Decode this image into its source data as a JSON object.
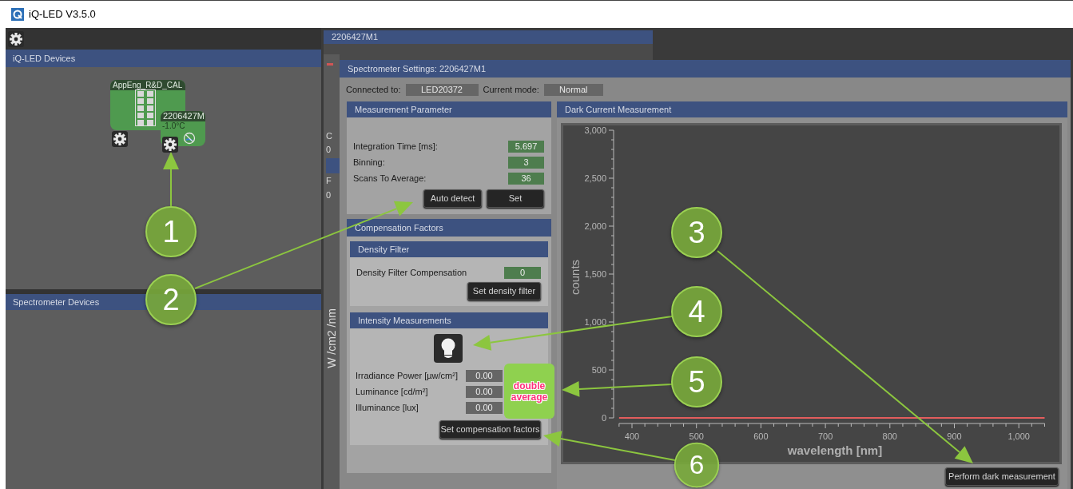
{
  "window": {
    "title": "iQ-LED V3.5.0"
  },
  "left_panel": {
    "sections": [
      {
        "title": "iQ-LED Devices"
      },
      {
        "title": "Spectrometer Devices"
      }
    ],
    "devices": [
      {
        "kind": "led",
        "name": "AppEng_R&D_CAL"
      },
      {
        "kind": "spectrometer",
        "name": "2206427M",
        "temperature": "-1.0°C"
      }
    ]
  },
  "background_window": {
    "tab": "2206427M1",
    "texts": [
      "C",
      "0",
      "F",
      "0"
    ],
    "axis_label": "W /cm2 /nm"
  },
  "dialog": {
    "title": "Spectrometer Settings: 2206427M1",
    "connected_label": "Connected to:",
    "connected_value": "LED20372",
    "mode_label": "Current mode:",
    "mode_value": "Normal",
    "measurement": {
      "title": "Measurement Parameter",
      "fields": [
        {
          "label": "Integration Time [ms]:",
          "value": "5.697"
        },
        {
          "label": "Binning:",
          "value": "3"
        },
        {
          "label": "Scans To Average:",
          "value": "36"
        }
      ],
      "buttons": [
        "Auto detect",
        "Set"
      ]
    },
    "compensation": {
      "title": "Compensation Factors",
      "density": {
        "title": "Density Filter",
        "label": "Density Filter Compensation",
        "value": "0",
        "button": "Set density filter"
      },
      "intensity": {
        "title": "Intensity Measurements",
        "fields": [
          {
            "label": "Irradiance Power [µw/cm²]",
            "value": "0.00"
          },
          {
            "label": "Luminance [cd/m²]",
            "value": "0.00"
          },
          {
            "label": "Illuminance [lux]",
            "value": "0.00"
          }
        ],
        "button": "Set compensation factors"
      }
    },
    "dark_current": {
      "title": "Dark Current Measurement",
      "button": "Perform dark measurement",
      "chart_data": {
        "type": "line",
        "xlabel": "wavelength [nm]",
        "ylabel": "counts",
        "xlim": [
          380,
          1040
        ],
        "ylim": [
          0,
          3000
        ],
        "x": [
          380,
          1040
        ],
        "series": [
          {
            "color": "#e35d5d",
            "values": [
              0,
              0
            ]
          }
        ],
        "xticks": [
          400,
          500,
          600,
          700,
          800,
          900,
          {
            "value": 1000,
            "label": "1,000"
          }
        ],
        "yticks": [
          0,
          500,
          {
            "value": 1000,
            "label": "1,000"
          },
          {
            "value": 1500,
            "label": "1,500"
          },
          {
            "value": 2000,
            "label": "2,000"
          },
          {
            "value": 2500,
            "label": "2,500"
          },
          {
            "value": 3000,
            "label": "3,000"
          }
        ]
      }
    }
  },
  "annotations": {
    "callouts": [
      {
        "number": "1"
      },
      {
        "number": "2"
      },
      {
        "number": "3"
      },
      {
        "number": "4"
      },
      {
        "number": "5"
      },
      {
        "number": "6"
      }
    ],
    "sticker": "double average"
  }
}
